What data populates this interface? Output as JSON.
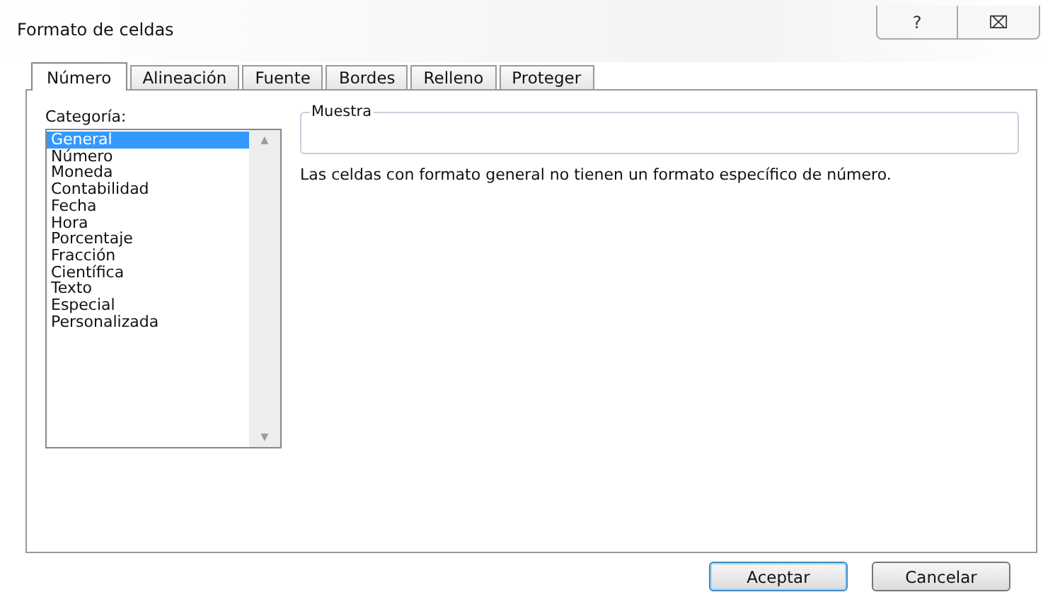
{
  "window": {
    "title": "Formato de celdas",
    "buttons": [
      "?",
      "⌧"
    ]
  },
  "tabs": [
    {
      "label": "Número",
      "selected": true
    },
    {
      "label": "Alineación",
      "selected": false
    },
    {
      "label": "Fuente",
      "selected": false
    },
    {
      "label": "Bordes",
      "selected": false
    },
    {
      "label": "Relleno",
      "selected": false
    },
    {
      "label": "Proteger",
      "selected": false
    }
  ],
  "category": {
    "label": "Categoría:",
    "scroll_up": "▲",
    "scroll_down": "▼",
    "items": [
      {
        "label": "General",
        "selected": true
      },
      {
        "label": "Número",
        "selected": false
      },
      {
        "label": "Moneda",
        "selected": false
      },
      {
        "label": "Contabilidad",
        "selected": false
      },
      {
        "label": "Fecha",
        "selected": false
      },
      {
        "label": "Hora",
        "selected": false
      },
      {
        "label": "Porcentaje",
        "selected": false
      },
      {
        "label": "Fracción",
        "selected": false
      },
      {
        "label": "Científica",
        "selected": false
      },
      {
        "label": "Texto",
        "selected": false
      },
      {
        "label": "Especial",
        "selected": false
      },
      {
        "label": "Personalizada",
        "selected": false
      }
    ]
  },
  "sample": {
    "label": "Muestra"
  },
  "description": "Las celdas con formato general no tienen un formato específico de número.",
  "buttons": [
    {
      "label": "Aceptar",
      "default": true
    },
    {
      "label": "Cancelar",
      "default": false
    }
  ]
}
